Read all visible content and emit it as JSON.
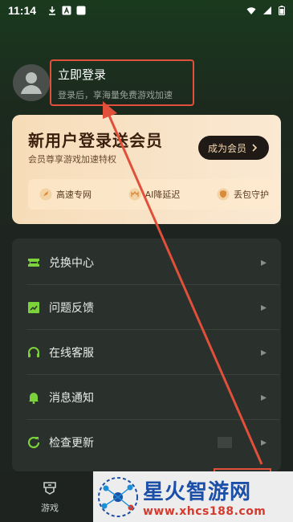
{
  "status_bar": {
    "time": "11:14"
  },
  "profile": {
    "login_title": "立即登录",
    "login_subtitle": "登录后，享海量免费游戏加速"
  },
  "promo": {
    "title": "新用户登录送会员",
    "subtitle": "会员尊享游戏加速特权",
    "button_label": "成为会员",
    "perks": [
      {
        "label": "高速专网",
        "icon": "rocket-icon"
      },
      {
        "label": "AI降延迟",
        "icon": "ai-speed-icon"
      },
      {
        "label": "丢包守护",
        "icon": "shield-check-icon"
      }
    ]
  },
  "menu": {
    "items": [
      {
        "label": "兑换中心",
        "icon": "ticket-icon"
      },
      {
        "label": "问题反馈",
        "icon": "feedback-icon"
      },
      {
        "label": "在线客服",
        "icon": "headset-icon"
      },
      {
        "label": "消息通知",
        "icon": "bell-icon"
      },
      {
        "label": "检查更新",
        "icon": "refresh-icon"
      }
    ]
  },
  "bottom_nav": {
    "tabs": [
      {
        "label": "游戏",
        "icon": "game-icon"
      }
    ]
  },
  "watermark": {
    "title": "星火智游网",
    "url": "www.xhcs188.com"
  },
  "colors": {
    "accent_green": "#7bd23a",
    "annotation_red": "#e0503a",
    "promo_bg": "#f8e1c2"
  }
}
